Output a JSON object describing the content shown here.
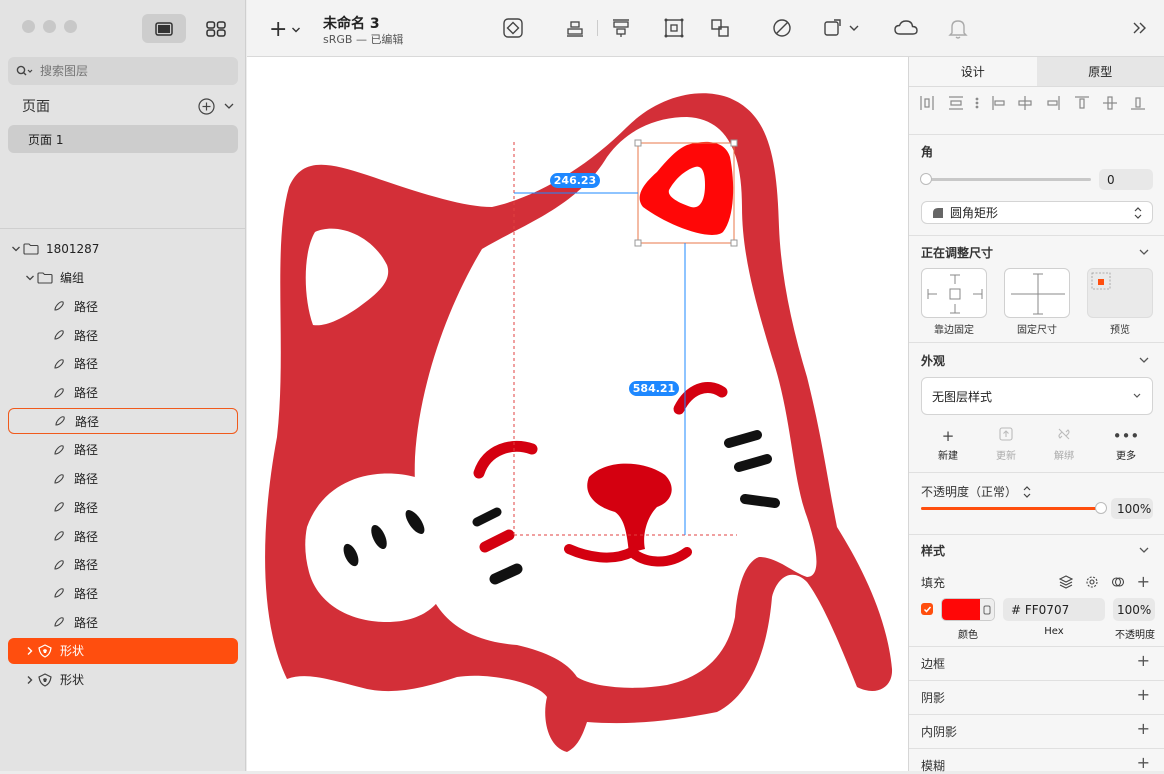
{
  "sidebar": {
    "search_placeholder": "搜索图层",
    "pages_label": "页面",
    "pages": [
      "页面 1"
    ],
    "layers": [
      {
        "label": "1801287",
        "icon": "folder-icon",
        "depth": 0,
        "chevron": "down",
        "state": "normal"
      },
      {
        "label": "编组",
        "icon": "folder-icon",
        "depth": 1,
        "chevron": "down",
        "state": "normal"
      },
      {
        "label": "路径",
        "icon": "path-icon",
        "depth": 2,
        "chevron": "",
        "state": "normal"
      },
      {
        "label": "路径",
        "icon": "path-icon",
        "depth": 2,
        "chevron": "",
        "state": "normal"
      },
      {
        "label": "路径",
        "icon": "path-icon",
        "depth": 2,
        "chevron": "",
        "state": "normal"
      },
      {
        "label": "路径",
        "icon": "path-icon",
        "depth": 2,
        "chevron": "",
        "state": "normal"
      },
      {
        "label": "路径",
        "icon": "path-icon",
        "depth": 2,
        "chevron": "",
        "state": "hover"
      },
      {
        "label": "路径",
        "icon": "path-icon",
        "depth": 2,
        "chevron": "",
        "state": "normal"
      },
      {
        "label": "路径",
        "icon": "path-icon",
        "depth": 2,
        "chevron": "",
        "state": "normal"
      },
      {
        "label": "路径",
        "icon": "path-icon",
        "depth": 2,
        "chevron": "",
        "state": "normal"
      },
      {
        "label": "路径",
        "icon": "path-icon",
        "depth": 2,
        "chevron": "",
        "state": "normal"
      },
      {
        "label": "路径",
        "icon": "path-icon",
        "depth": 2,
        "chevron": "",
        "state": "normal"
      },
      {
        "label": "路径",
        "icon": "path-icon",
        "depth": 2,
        "chevron": "",
        "state": "normal"
      },
      {
        "label": "路径",
        "icon": "path-icon",
        "depth": 2,
        "chevron": "",
        "state": "normal"
      },
      {
        "label": "形状",
        "icon": "shape-icon",
        "depth": 1,
        "chevron": "right",
        "state": "selected"
      },
      {
        "label": "形状",
        "icon": "shape-icon",
        "depth": 1,
        "chevron": "right",
        "state": "normal"
      }
    ]
  },
  "toolbar": {
    "doc_title": "未命名 3",
    "doc_subtitle": "sRGB — 已编辑"
  },
  "canvas": {
    "measure_horizontal": "246.23",
    "measure_vertical": "584.21",
    "selection_fill": "#FF0707",
    "cat_color": "#D32F38"
  },
  "inspector": {
    "tab_design": "设计",
    "tab_prototype": "原型",
    "corner": {
      "title": "角",
      "value": "0",
      "type": "圆角矩形"
    },
    "resize": {
      "title": "正在调整尺寸",
      "options": [
        "靠边固定",
        "固定尺寸",
        "预览"
      ]
    },
    "appearance": {
      "title": "外观",
      "style_select": "无图层样式",
      "actions": [
        {
          "label": "新建",
          "icon": "plus-icon",
          "enabled": true
        },
        {
          "label": "更新",
          "icon": "update-icon",
          "enabled": false
        },
        {
          "label": "解绑",
          "icon": "unlink-icon",
          "enabled": false
        },
        {
          "label": "更多",
          "icon": "more-icon",
          "enabled": true
        }
      ],
      "opacity_label": "不透明度（正常）",
      "opacity_value": "100%",
      "opacity_fraction": 1.0
    },
    "style": {
      "title": "样式",
      "fill_label": "填充",
      "fill_hex": "# FF0707",
      "fill_opacity": "100%",
      "fill_color": "#FF0707",
      "caption_color": "颜色",
      "caption_hex": "Hex",
      "caption_opacity": "不透明度",
      "rows": [
        "边框",
        "阴影",
        "内阴影",
        "模糊"
      ]
    }
  }
}
